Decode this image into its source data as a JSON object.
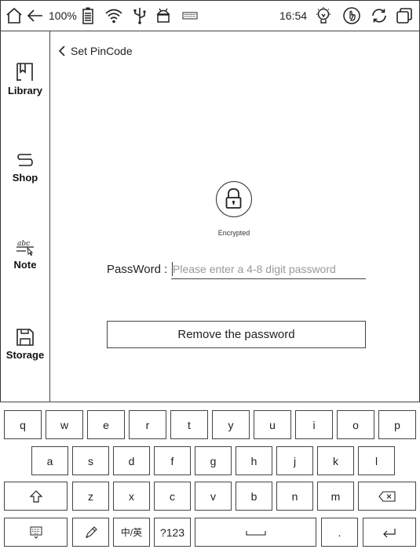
{
  "status_bar": {
    "battery_percent": "100%",
    "time": "16:54",
    "icons": [
      "home-icon",
      "back-arrow-icon",
      "battery-icon",
      "wifi-icon",
      "usb-icon",
      "android-icon",
      "keyboard-icon",
      "bulb-icon",
      "touch-icon",
      "refresh-icon",
      "window-icon"
    ]
  },
  "sidebar": {
    "items": [
      {
        "label": "Library",
        "icon": "library-icon"
      },
      {
        "label": "Shop",
        "icon": "shop-icon"
      },
      {
        "label": "Note",
        "icon": "note-icon"
      },
      {
        "label": "Storage",
        "icon": "storage-icon"
      }
    ]
  },
  "page": {
    "back_label": "Set PinCode",
    "lock_caption": "Encrypted",
    "password_label": "PassWord :",
    "password_placeholder": "Please enter a 4-8 digit password",
    "password_value": "",
    "remove_button": "Remove the password"
  },
  "keyboard": {
    "row1": [
      "q",
      "w",
      "e",
      "r",
      "t",
      "y",
      "u",
      "i",
      "o",
      "p"
    ],
    "row2": [
      "a",
      "s",
      "d",
      "f",
      "g",
      "h",
      "j",
      "k",
      "l"
    ],
    "row3": [
      "z",
      "x",
      "c",
      "v",
      "b",
      "n",
      "m"
    ],
    "lang_key": "中/英",
    "num_key": "?123",
    "period_key": "."
  }
}
